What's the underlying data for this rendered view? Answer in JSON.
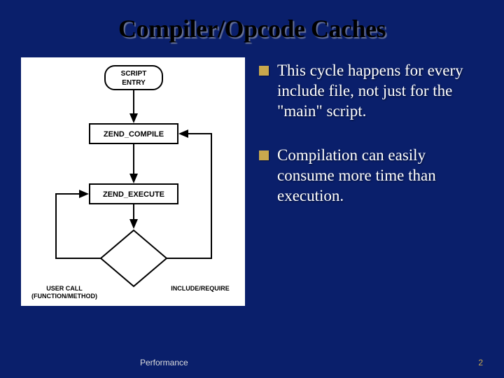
{
  "title": "Compiler/Opcode Caches",
  "bullets": [
    "This cycle happens for every include file, not just for the \"main\" script.",
    "Compilation can easily consume more time than execution."
  ],
  "diagram": {
    "node_script_entry": "SCRIPT\nENTRY",
    "node_zend_compile": "ZEND_COMPILE",
    "node_zend_execute": "ZEND_EXECUTE",
    "label_user_call_line1": "USER CALL",
    "label_user_call_line2": "(FUNCTION/METHOD)",
    "label_include_require": "INCLUDE/REQUIRE"
  },
  "footer": {
    "left": "Performance",
    "page": "2"
  }
}
